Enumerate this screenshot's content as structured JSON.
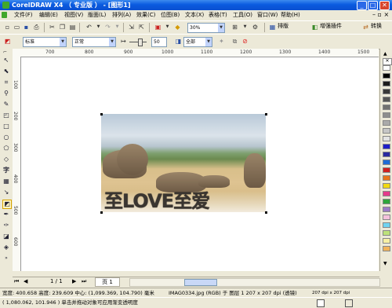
{
  "window": {
    "title": "CorelDRAW X4 （ 专业版 ） - [图形1]",
    "min": "_",
    "max": "□",
    "close": "✕"
  },
  "menu": [
    "文件(F)",
    "编辑(E)",
    "视图(V)",
    "版面(L)",
    "排列(A)",
    "效果(C)",
    "位图(B)",
    "文本(X)",
    "表格(T)",
    "工具(O)",
    "窗口(W)",
    "帮助(H)"
  ],
  "toolbar1": {
    "zoom": "30%",
    "layout_label": "排版",
    "enhance_label": "增强插件",
    "convert_label": "转换"
  },
  "toolbar2": {
    "style": "标准",
    "merge_mode": "正常",
    "transparency": "50",
    "target": "全部"
  },
  "rulers": {
    "h_ticks": [
      "700",
      "800",
      "900",
      "1000",
      "1100",
      "1200",
      "1300",
      "1400",
      "1500"
    ],
    "v_ticks": [
      "100",
      "200",
      "300",
      "400",
      "500",
      "600",
      "700"
    ]
  },
  "canvas": {
    "overlay_text": "至LOVE至爱"
  },
  "pagenav": {
    "page_count": "1 / 1",
    "page_tab": "页 1"
  },
  "status": {
    "line1": "宽度: 400.658 高度: 239.609 中心: (1,099.369, 104.790) 毫米",
    "object_info": "IMAG0334.jpg (RGB) 于 图层 1 207 x 207 dpi (透镜)",
    "dpi_info": "207 dpi x 207 dpi",
    "line2": "( 1,080.062, 101.946 ) 单击并拖动对象可应用渐变透明度"
  },
  "colors": {
    "title_bar": "#0a5be0",
    "palette": [
      "#ffffff",
      "#000000",
      "#1c1c1c",
      "#383838",
      "#555555",
      "#717171",
      "#8e8e8e",
      "#aaaaaa",
      "#c6c6c6",
      "#e3e3e3",
      "#1f1fc8",
      "#2a2aa0",
      "#1e6bd6",
      "#d11f1f",
      "#e8741b",
      "#f1d90f",
      "#e53b8b",
      "#2ea53a",
      "#9b7ac6",
      "#f4c1dc",
      "#6fd3f0",
      "#bde27a",
      "#f7f0a3",
      "#f1b35a"
    ]
  }
}
